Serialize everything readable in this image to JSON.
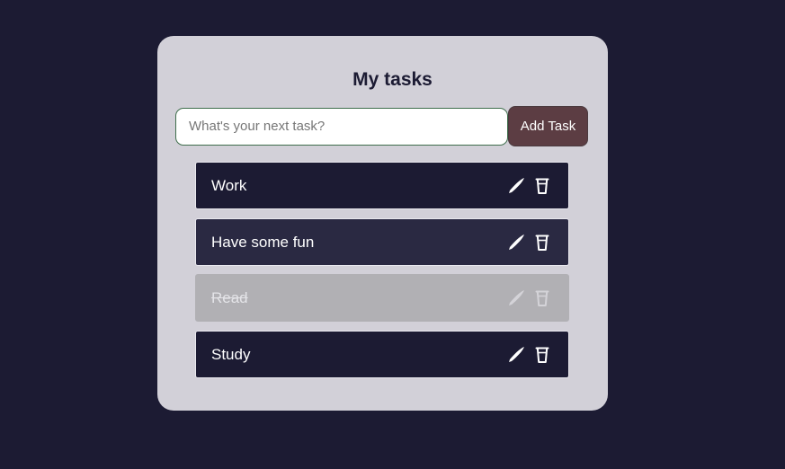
{
  "header": {
    "title": "My tasks"
  },
  "form": {
    "input_value": "",
    "placeholder": "What's your next task?",
    "add_label": "Add Task"
  },
  "tasks": [
    {
      "text": "Work",
      "completed": false
    },
    {
      "text": "Have some fun",
      "completed": false
    },
    {
      "text": "Read",
      "completed": true
    },
    {
      "text": "Study",
      "completed": false
    }
  ],
  "icons": {
    "edit": "pen-icon",
    "delete": "trash-icon"
  },
  "colors": {
    "background": "#1c1b33",
    "card": "#d2d0d8",
    "task": "#1c1b33",
    "task_hover": "#2a2942",
    "task_completed": "#b1b0b4",
    "add_button": "#5c3d43",
    "input_border": "#3f6e4c"
  }
}
